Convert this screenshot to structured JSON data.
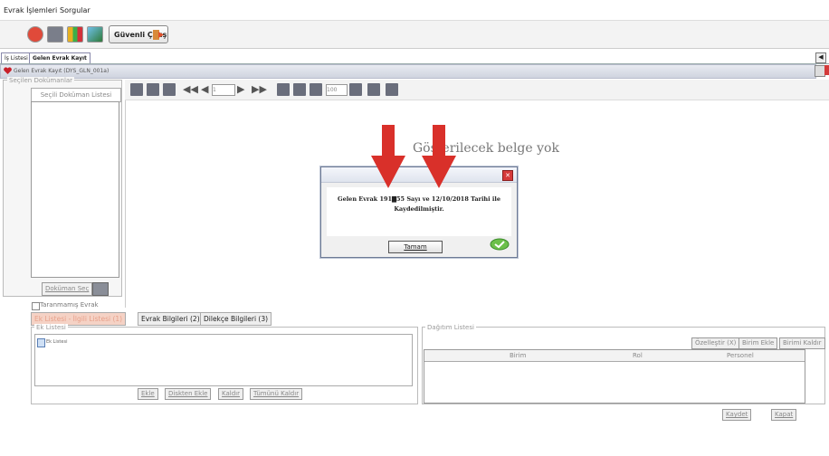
{
  "menu": [
    "Evrak İşlemleri",
    "Sorgular"
  ],
  "toolbar": {
    "logout_label": "Güvenli Çıkış"
  },
  "tabs": [
    "İş Listesi",
    "Gelen Evrak Kayıt"
  ],
  "window_title": "Gelen Evrak Kayıt (DYS_GLN_001a)",
  "left_panel": {
    "group_label": "Seçilen Dokümanlar",
    "list_title": "Seçili Doküman Listesi",
    "select_button": "Doküman Seç",
    "checkbox_label": "Taranmamış Evrak"
  },
  "viewer": {
    "zoom": "100",
    "page": "1",
    "empty_message": "Gösterilecek belge yok"
  },
  "dialog": {
    "message_line1": "Gelen Evrak 191▇55 Sayı ve 12/10/2018 Tarihi ile",
    "message_line2": "Kaydedilmiştir.",
    "ok_label": "Tamam"
  },
  "bottom_tabs": [
    "Ek Listesi - İlgili Listesi (1)",
    "Evrak Bilgileri (2)",
    "Dilekçe Bilgileri (3)"
  ],
  "ek_listesi": {
    "group_label": "Ek Listesi",
    "item": "Ek Listesi",
    "buttons": [
      "Ekle",
      "Diskten Ekle",
      "Kaldır",
      "Tümünü Kaldır"
    ]
  },
  "dagitim": {
    "group_label": "Dağıtım Listesi",
    "buttons": [
      "Özelleştir (X)",
      "Birim Ekle",
      "Birimi Kaldır"
    ],
    "columns": [
      "Birim",
      "Rol",
      "Personel"
    ]
  },
  "footer_buttons": [
    "Kaydet",
    "Kapat"
  ],
  "colors": {
    "arrow": "#d9302a",
    "title_bar": "#cfd4df",
    "accent_blue": "#3b6fd6"
  }
}
